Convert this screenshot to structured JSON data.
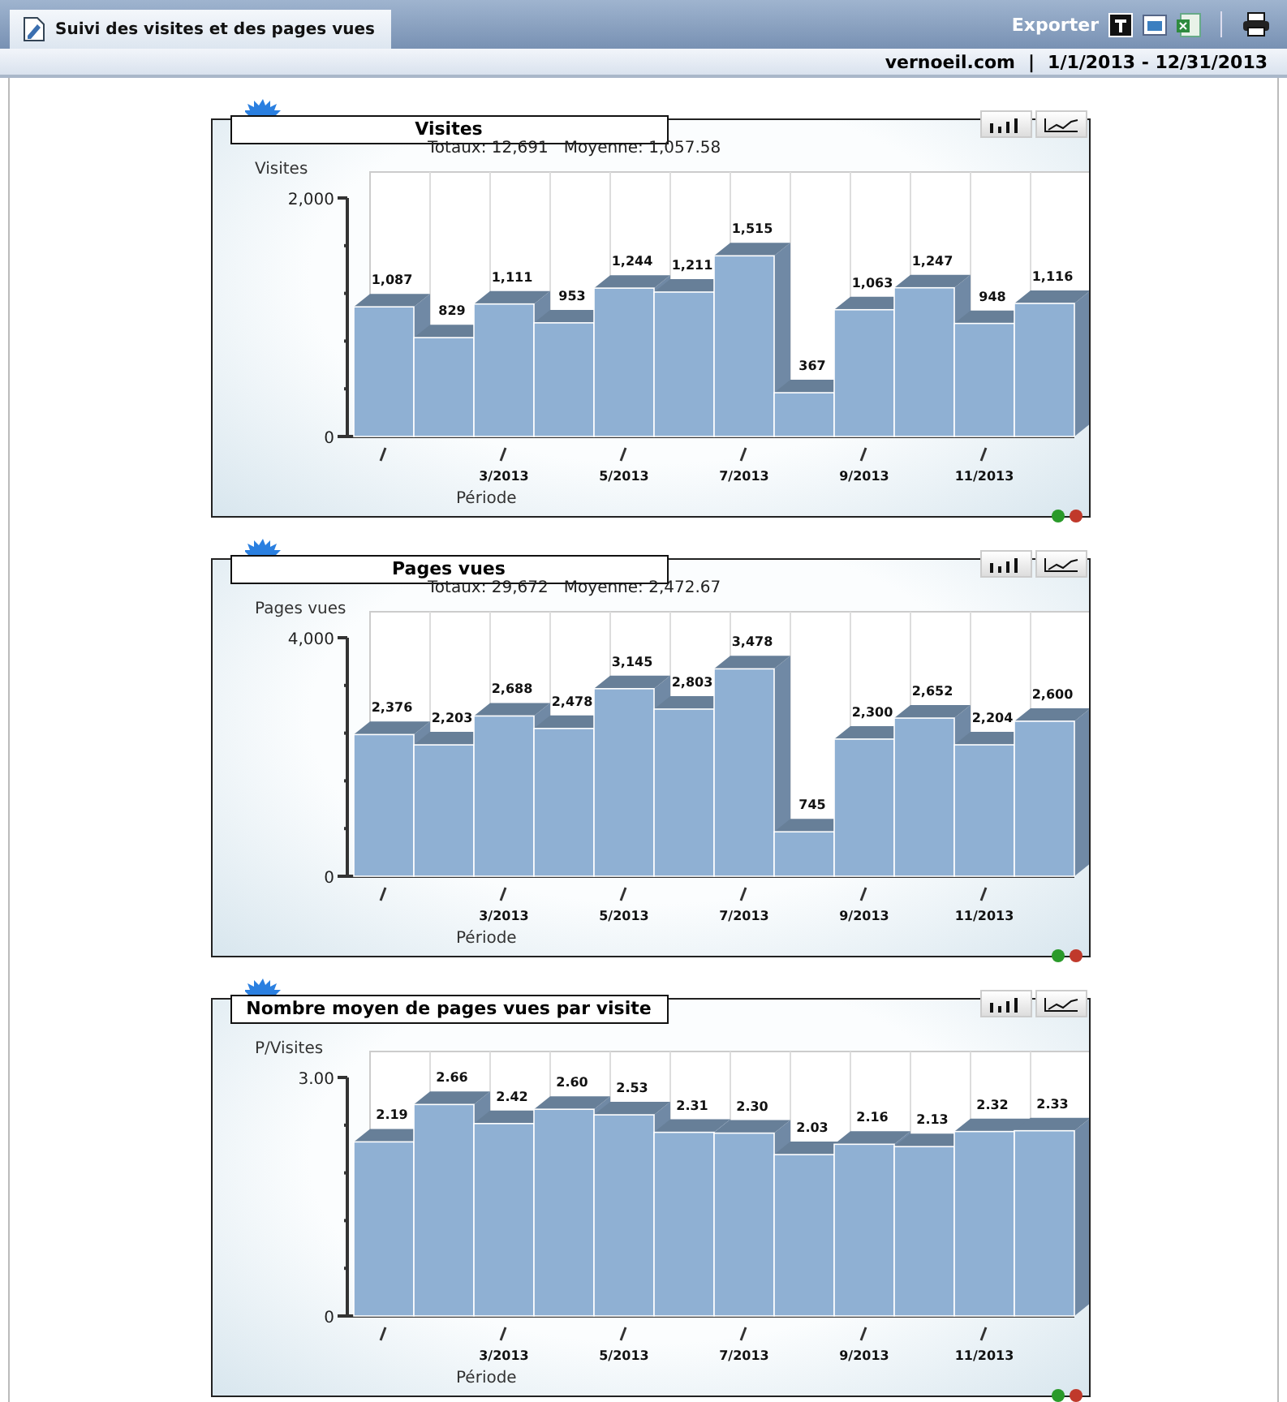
{
  "header": {
    "tab": "Suivi des visites et des pages vues",
    "export_label": "Exporter",
    "site": "vernoeil.com",
    "separator": "|",
    "date_range": "1/1/2013 - 12/31/2013"
  },
  "panels": [
    {
      "title": "Visites",
      "summary": "Totaux: 12,691   Moyenne: 1,057.58",
      "chart_data": {
        "type": "bar",
        "xlabel": "Période",
        "ylabel": "Visites",
        "categories": [
          null,
          null,
          "3/2013",
          null,
          "5/2013",
          null,
          "7/2013",
          null,
          "9/2013",
          null,
          "11/2013",
          null
        ],
        "ylim": [
          0,
          2000
        ],
        "yticks": [
          {
            "value": 0,
            "label": "0"
          },
          {
            "value": 2000,
            "label": "2,000"
          }
        ],
        "series": [
          {
            "color": "#8fb0d3",
            "values": [
              1087,
              829,
              1111,
              953,
              1244,
              1211,
              1515,
              367,
              1063,
              1247,
              948,
              1116
            ]
          }
        ],
        "value_labels": [
          "1,087",
          "829",
          "1,111",
          "953",
          "1,244",
          "1,211",
          "1,515",
          "367",
          "1,063",
          "1,247",
          "948",
          "1,116"
        ]
      }
    },
    {
      "title": "Pages vues",
      "summary": "Totaux: 29,672   Moyenne: 2,472.67",
      "chart_data": {
        "type": "bar",
        "xlabel": "Période",
        "ylabel": "Pages vues",
        "categories": [
          null,
          null,
          "3/2013",
          null,
          "5/2013",
          null,
          "7/2013",
          null,
          "9/2013",
          null,
          "11/2013",
          null
        ],
        "ylim": [
          0,
          4000
        ],
        "yticks": [
          {
            "value": 0,
            "label": "0"
          },
          {
            "value": 4000,
            "label": "4,000"
          }
        ],
        "series": [
          {
            "color": "#8fb0d3",
            "values": [
              2376,
              2203,
              2688,
              2478,
              3145,
              2803,
              3478,
              745,
              2300,
              2652,
              2204,
              2600
            ]
          }
        ],
        "value_labels": [
          "2,376",
          "2,203",
          "2,688",
          "2,478",
          "3,145",
          "2,803",
          "3,478",
          "745",
          "2,300",
          "2,652",
          "2,204",
          "2,600"
        ]
      }
    },
    {
      "title": "Nombre moyen de pages vues par visite",
      "chart_data": {
        "type": "bar",
        "xlabel": "Période",
        "ylabel": "P/Visites",
        "categories": [
          null,
          null,
          "3/2013",
          null,
          "5/2013",
          null,
          "7/2013",
          null,
          "9/2013",
          null,
          "11/2013",
          null
        ],
        "ylim": [
          0,
          3
        ],
        "yticks": [
          {
            "value": 0,
            "label": "0"
          },
          {
            "value": 3,
            "label": "3.00"
          }
        ],
        "series": [
          {
            "color": "#8fb0d3",
            "values": [
              2.19,
              2.66,
              2.42,
              2.6,
              2.53,
              2.31,
              2.3,
              2.03,
              2.16,
              2.13,
              2.32,
              2.33
            ]
          }
        ],
        "value_labels": [
          "2.19",
          "2.66",
          "2.42",
          "2.60",
          "2.53",
          "2.31",
          "2.30",
          "2.03",
          "2.16",
          "2.13",
          "2.32",
          "2.33"
        ]
      }
    }
  ]
}
